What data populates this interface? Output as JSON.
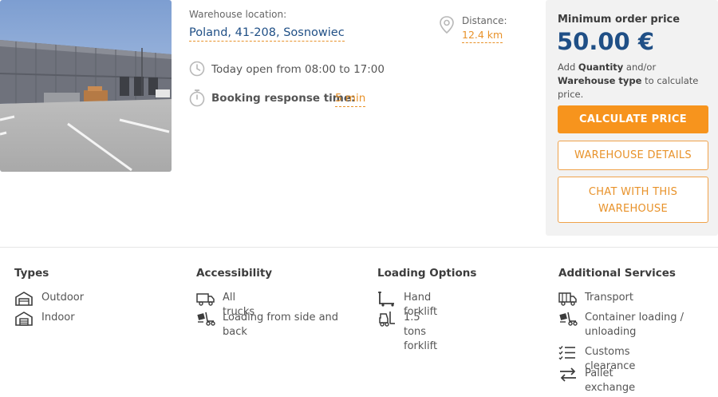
{
  "listing": {
    "location_label": "Warehouse location:",
    "location_value": "Poland, 41-208, Sosnowiec",
    "distance_label": "Distance:",
    "distance_value": "12.4 km",
    "hours": "Today open from 08:00 to 17:00",
    "response_label": "Booking response time:",
    "response_value": "5 min"
  },
  "pricing": {
    "title": "Minimum order price",
    "price": "50.00 €",
    "note_pre": "Add ",
    "note_quantity": "Quantity",
    "note_mid": " and/or ",
    "note_type": "Warehouse type",
    "note_post": " to calculate price.",
    "calc_button": "CALCULATE PRICE",
    "details_button": "WAREHOUSE DETAILS",
    "chat_button_line1": "CHAT WITH THIS",
    "chat_button_line2": "WAREHOUSE"
  },
  "features": {
    "types": {
      "title": "Types",
      "items": [
        {
          "label": "Outdoor",
          "icon": "outdoor-shelter-icon"
        },
        {
          "label": "Indoor",
          "icon": "warehouse-building-icon"
        }
      ]
    },
    "accessibility": {
      "title": "Accessibility",
      "items": [
        {
          "label": "All trucks",
          "icon": "truck-icon"
        },
        {
          "label_line1": "Loading from side and",
          "label_line2": "back",
          "icon": "loading-dolly-icon"
        }
      ]
    },
    "loading_options": {
      "title": "Loading Options",
      "items": [
        {
          "label": "Hand forklift",
          "icon": "hand-forklift-icon"
        },
        {
          "label": "1.5 tons forklift",
          "icon": "forklift-icon"
        }
      ]
    },
    "additional_services": {
      "title": "Additional Services",
      "items": [
        {
          "label": "Transport",
          "icon": "transport-truck-icon"
        },
        {
          "label_line1": "Container loading /",
          "label_line2": "unloading",
          "icon": "container-loading-icon"
        },
        {
          "label": "Customs clearance",
          "icon": "checklist-icon"
        },
        {
          "label": "Pallet exchange",
          "icon": "exchange-arrows-icon"
        }
      ]
    }
  },
  "colors": {
    "accent_orange": "#f7941d",
    "brand_blue": "#1f4f86",
    "panel_gray": "#f2f2f2"
  }
}
